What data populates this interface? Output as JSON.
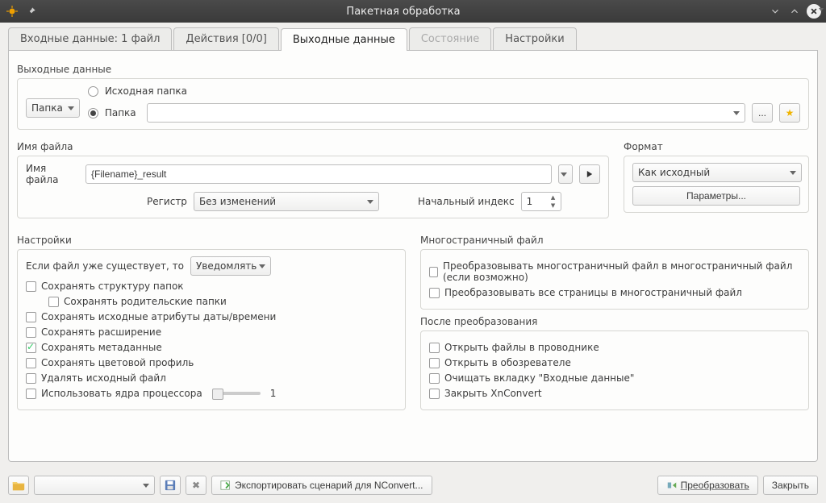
{
  "window": {
    "title": "Пакетная обработка"
  },
  "tabs": {
    "input": "Входные данные: 1 файл",
    "actions": "Действия [0/0]",
    "output": "Выходные данные",
    "status": "Состояние",
    "settings": "Настройки"
  },
  "output": {
    "section_label": "Выходные данные",
    "dest_combo": "Папка",
    "radio_source_folder": "Исходная папка",
    "radio_folder": "Папка",
    "path_value": "",
    "browse_tooltip": "...",
    "fav_tooltip": "Избранное"
  },
  "filename": {
    "section_label": "Имя файла",
    "field_label": "Имя файла",
    "pattern_value": "{Filename}_result",
    "case_label": "Регистр",
    "case_value": "Без изменений",
    "index_label": "Начальный индекс",
    "index_value": "1"
  },
  "format": {
    "section_label": "Формат",
    "value": "Как исходный",
    "params_button": "Параметры..."
  },
  "settings": {
    "section_label": "Настройки",
    "exists_prefix": "Если файл уже существует, то",
    "exists_value": "Уведомлять",
    "keep_folder_structure": "Сохранять структуру папок",
    "keep_parent_folders": "Сохранять родительские папки",
    "keep_date_attrs": "Сохранять исходные атрибуты даты/времени",
    "keep_extension": "Сохранять расширение",
    "keep_metadata": "Сохранять метаданные",
    "keep_color_profile": "Сохранять цветовой профиль",
    "delete_source": "Удалять исходный файл",
    "use_cpu_cores": "Использовать ядра процессора",
    "cores_value": "1"
  },
  "multipage": {
    "section_label": "Многостраничный файл",
    "convert_if_possible": "Преобразовывать многостраничный файл в многостраничный файл (если возможно)",
    "convert_all_pages": "Преобразовывать все страницы в многостраничный файл"
  },
  "after": {
    "section_label": "После преобразования",
    "open_in_explorer": "Открыть файлы в проводнике",
    "open_in_browser": "Открыть в обозревателе",
    "clear_input_tab": "Очищать вкладку \"Входные данные\"",
    "close_app": "Закрыть XnConvert"
  },
  "bottom": {
    "export_nconvert": "Экспортировать сценарий для NConvert...",
    "convert": "Преобразовать",
    "close": "Закрыть"
  }
}
